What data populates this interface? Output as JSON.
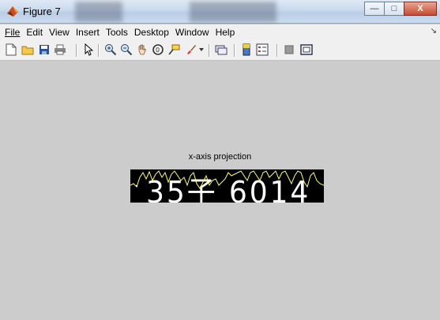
{
  "window": {
    "title": "Figure 7",
    "buttons": {
      "minimize": "—",
      "maximize": "□",
      "close": "X"
    }
  },
  "menubar": {
    "items": [
      "File",
      "Edit",
      "View",
      "Insert",
      "Tools",
      "Desktop",
      "Window",
      "Help"
    ],
    "dock_arrow": "↘"
  },
  "toolbar": {
    "icons": [
      "new-figure-icon",
      "open-file-icon",
      "save-icon",
      "print-icon",
      "select-arrow-icon",
      "zoom-in-icon",
      "zoom-out-icon",
      "pan-hand-icon",
      "rotate-3d-icon",
      "data-cursor-icon",
      "brush-icon",
      "link-plot-icon",
      "colorbar-icon",
      "legend-icon",
      "hide-plot-tools-icon",
      "show-plot-tools-icon"
    ]
  },
  "axes": {
    "title": "x-axis projection",
    "image_text": "35子 6014"
  },
  "colors": {
    "figure_bg": "#cccccc",
    "projection_line": "#ffff66"
  }
}
